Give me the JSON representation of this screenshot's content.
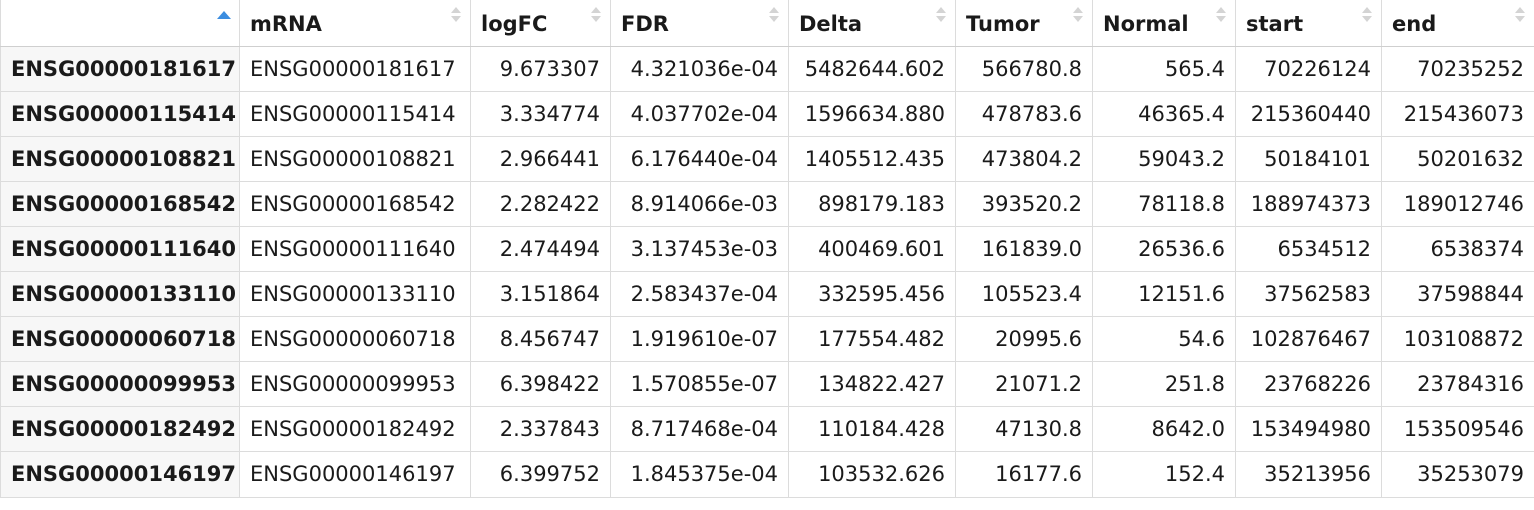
{
  "table": {
    "sorted_column_index": 0,
    "columns": [
      {
        "key": "rowname",
        "label": ""
      },
      {
        "key": "mRNA",
        "label": "mRNA"
      },
      {
        "key": "logFC",
        "label": "logFC"
      },
      {
        "key": "FDR",
        "label": "FDR"
      },
      {
        "key": "Delta",
        "label": "Delta"
      },
      {
        "key": "Tumor",
        "label": "Tumor"
      },
      {
        "key": "Normal",
        "label": "Normal"
      },
      {
        "key": "start",
        "label": "start"
      },
      {
        "key": "end",
        "label": "end"
      }
    ],
    "rows": [
      [
        "ENSG00000181617",
        "ENSG00000181617",
        "9.673307",
        "4.321036e-04",
        "5482644.602",
        "566780.8",
        "565.4",
        "70226124",
        "70235252"
      ],
      [
        "ENSG00000115414",
        "ENSG00000115414",
        "3.334774",
        "4.037702e-04",
        "1596634.880",
        "478783.6",
        "46365.4",
        "215360440",
        "215436073"
      ],
      [
        "ENSG00000108821",
        "ENSG00000108821",
        "2.966441",
        "6.176440e-04",
        "1405512.435",
        "473804.2",
        "59043.2",
        "50184101",
        "50201632"
      ],
      [
        "ENSG00000168542",
        "ENSG00000168542",
        "2.282422",
        "8.914066e-03",
        "898179.183",
        "393520.2",
        "78118.8",
        "188974373",
        "189012746"
      ],
      [
        "ENSG00000111640",
        "ENSG00000111640",
        "2.474494",
        "3.137453e-03",
        "400469.601",
        "161839.0",
        "26536.6",
        "6534512",
        "6538374"
      ],
      [
        "ENSG00000133110",
        "ENSG00000133110",
        "3.151864",
        "2.583437e-04",
        "332595.456",
        "105523.4",
        "12151.6",
        "37562583",
        "37598844"
      ],
      [
        "ENSG00000060718",
        "ENSG00000060718",
        "8.456747",
        "1.919610e-07",
        "177554.482",
        "20995.6",
        "54.6",
        "102876467",
        "103108872"
      ],
      [
        "ENSG00000099953",
        "ENSG00000099953",
        "6.398422",
        "1.570855e-07",
        "134822.427",
        "21071.2",
        "251.8",
        "23768226",
        "23784316"
      ],
      [
        "ENSG00000182492",
        "ENSG00000182492",
        "2.337843",
        "8.717468e-04",
        "110184.428",
        "47130.8",
        "8642.0",
        "153494980",
        "153509546"
      ],
      [
        "ENSG00000146197",
        "ENSG00000146197",
        "6.399752",
        "1.845375e-04",
        "103532.626",
        "16177.6",
        "152.4",
        "35213956",
        "35253079"
      ]
    ]
  },
  "colors": {
    "sort_active": "#3b8de0",
    "sort_inactive": "#d4d4d4",
    "border": "#dcdcdc",
    "rowname_bg": "#f7f7f7"
  }
}
